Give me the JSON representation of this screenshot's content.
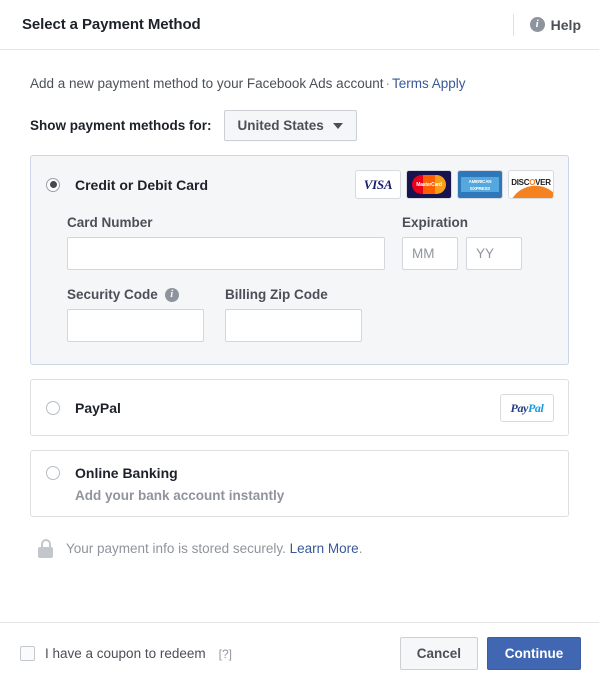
{
  "header": {
    "title": "Select a Payment Method",
    "help_label": "Help",
    "help_icon": "info-icon"
  },
  "intro": {
    "text": "Add a new payment method to your Facebook Ads account",
    "separator": "·",
    "terms_link": "Terms Apply"
  },
  "country": {
    "label": "Show payment methods for:",
    "selected": "United States",
    "caret_icon": "chevron-down-icon"
  },
  "options": [
    {
      "id": "credit-debit-card",
      "label": "Credit or Debit Card",
      "selected": true,
      "logos": [
        "VISA",
        "MasterCard",
        "AMERICAN EXPRESS",
        "DISCOVER"
      ]
    },
    {
      "id": "paypal",
      "label": "PayPal",
      "selected": false,
      "logo_a": "Pay",
      "logo_b": "Pal"
    },
    {
      "id": "online-banking",
      "label": "Online Banking",
      "sublabel": "Add your bank account instantly",
      "selected": false
    }
  ],
  "card_form": {
    "card_number_label": "Card Number",
    "card_number_value": "",
    "card_number_placeholder": "",
    "expiration_label": "Expiration",
    "exp_month_placeholder": "MM",
    "exp_month_value": "",
    "exp_year_placeholder": "YY",
    "exp_year_value": "",
    "security_code_label": "Security Code",
    "security_code_value": "",
    "security_code_placeholder": "",
    "security_info_icon": "info-icon",
    "billing_zip_label": "Billing Zip Code",
    "billing_zip_value": "",
    "billing_zip_placeholder": ""
  },
  "secure_note": {
    "lock_icon": "lock-icon",
    "text": "Your payment info is stored securely.",
    "link": "Learn More",
    "period": "."
  },
  "footer": {
    "coupon_label": "I have a coupon to redeem",
    "coupon_help": "[?]",
    "coupon_checked": false,
    "cancel_label": "Cancel",
    "continue_label": "Continue"
  },
  "colors": {
    "primary": "#4267b2",
    "link": "#385898",
    "muted": "#90949c",
    "panel_selected_bg": "#f5f6f8"
  },
  "brand_logos": {
    "visa": "VISA",
    "mastercard": "MasterCard",
    "amex_top": "AMERICAN",
    "amex_bottom": "EXPRESS",
    "discover_pre": "DISC",
    "discover_o": "O",
    "discover_post": "VER"
  }
}
